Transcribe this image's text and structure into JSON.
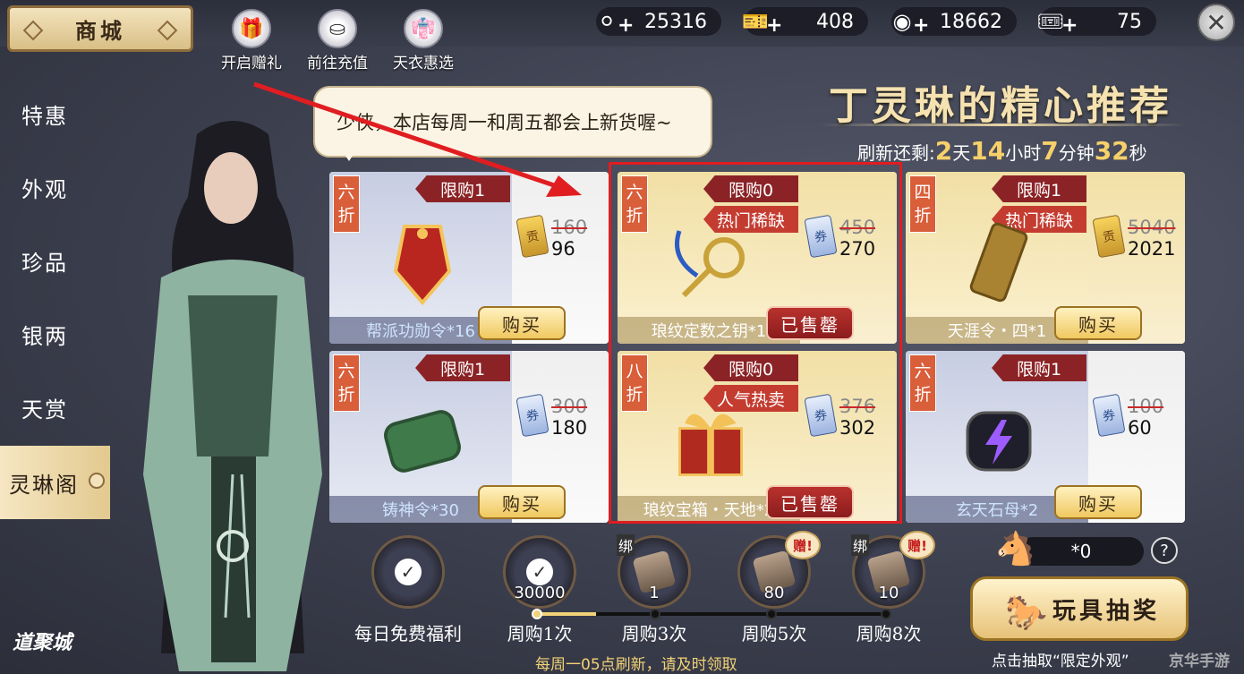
{
  "header": {
    "title": "商城",
    "quick_links": [
      {
        "label": "开启赠礼",
        "icon": "gift-box-icon"
      },
      {
        "label": "前往充值",
        "icon": "ingot-icon"
      },
      {
        "label": "天衣惠选",
        "icon": "costume-icon"
      }
    ],
    "resources": [
      {
        "icon": "silver-ingot-icon",
        "value": "25316"
      },
      {
        "icon": "blue-ticket-icon",
        "value": "408"
      },
      {
        "icon": "coin-icon",
        "value": "18662"
      },
      {
        "icon": "gold-ticket-icon",
        "value": "75"
      }
    ]
  },
  "sidebar": {
    "items": [
      {
        "label": "特惠"
      },
      {
        "label": "外观"
      },
      {
        "label": "珍品"
      },
      {
        "label": "银两"
      },
      {
        "label": "天赏"
      },
      {
        "label": "灵琳阁"
      }
    ],
    "active_index": 5,
    "brand": "道聚城"
  },
  "npc": {
    "speech": "少侠，本店每周一和周五都会上新货喔~"
  },
  "recommend": {
    "title": "丁灵琳的精心推荐",
    "refresh_label": "刷新还剩:",
    "days": "2",
    "days_unit": "天",
    "hours": "14",
    "hours_unit": "小时",
    "minutes": "7",
    "minutes_unit": "分钟",
    "seconds": "32",
    "seconds_unit": "秒"
  },
  "products": [
    {
      "discount": [
        "六",
        "折"
      ],
      "limit": "限购1",
      "tag": "",
      "name": "帮派功勋令*16",
      "currency": "gold",
      "old_price": "160",
      "price": "96",
      "status": "购买",
      "sold_out": false,
      "theme": "blue"
    },
    {
      "discount": [
        "六",
        "折"
      ],
      "limit": "限购0",
      "tag": "热门稀缺",
      "name": "琅纹定数之钥*1",
      "currency": "blue",
      "old_price": "450",
      "price": "270",
      "status": "已售罄",
      "sold_out": true,
      "theme": "gold"
    },
    {
      "discount": [
        "四",
        "折"
      ],
      "limit": "限购1",
      "tag": "热门稀缺",
      "name": "天涯令・四*1",
      "currency": "gold",
      "old_price": "5040",
      "price": "2021",
      "status": "购买",
      "sold_out": false,
      "theme": "gold"
    },
    {
      "discount": [
        "六",
        "折"
      ],
      "limit": "限购1",
      "tag": "",
      "name": "铸神令*30",
      "currency": "blue",
      "old_price": "300",
      "price": "180",
      "status": "购买",
      "sold_out": false,
      "theme": "blue"
    },
    {
      "discount": [
        "八",
        "折"
      ],
      "limit": "限购0",
      "tag": "人气热卖",
      "name": "琅纹宝箱・天地*2",
      "currency": "blue",
      "old_price": "376",
      "price": "302",
      "status": "已售罄",
      "sold_out": true,
      "theme": "gold"
    },
    {
      "discount": [
        "六",
        "折"
      ],
      "limit": "限购1",
      "tag": "",
      "name": "玄天石母*2",
      "currency": "blue",
      "old_price": "100",
      "price": "60",
      "status": "购买",
      "sold_out": false,
      "theme": "blue"
    }
  ],
  "currency_glyphs": {
    "gold": "贡",
    "blue": "券"
  },
  "weekly": {
    "rewards": [
      {
        "label": "每日免费福利",
        "qty": "",
        "claimed": true,
        "bound": "",
        "gift": ""
      },
      {
        "label": "周购1次",
        "qty": "30000",
        "claimed": true,
        "bound": "",
        "gift": ""
      },
      {
        "label": "周购3次",
        "qty": "1",
        "claimed": false,
        "bound": "绑",
        "gift": ""
      },
      {
        "label": "周购5次",
        "qty": "80",
        "claimed": false,
        "bound": "",
        "gift": "赠!"
      },
      {
        "label": "周购8次",
        "qty": "10",
        "claimed": false,
        "bound": "绑",
        "gift": "赠!"
      }
    ],
    "progress_fraction": 0.17,
    "footer": "每周一05点刷新，请及时领取"
  },
  "toy_draw": {
    "count": "*0",
    "help": "?",
    "button": "玩具抽奖",
    "note": "点击抽取“限定外观”"
  },
  "watermark": "京华手游",
  "colors": {
    "accent_gold": "#f1d277",
    "sold_out_red": "#8b1c1d",
    "highlight_box": "#e01d21",
    "annotation_arrow": "#e01d21"
  }
}
